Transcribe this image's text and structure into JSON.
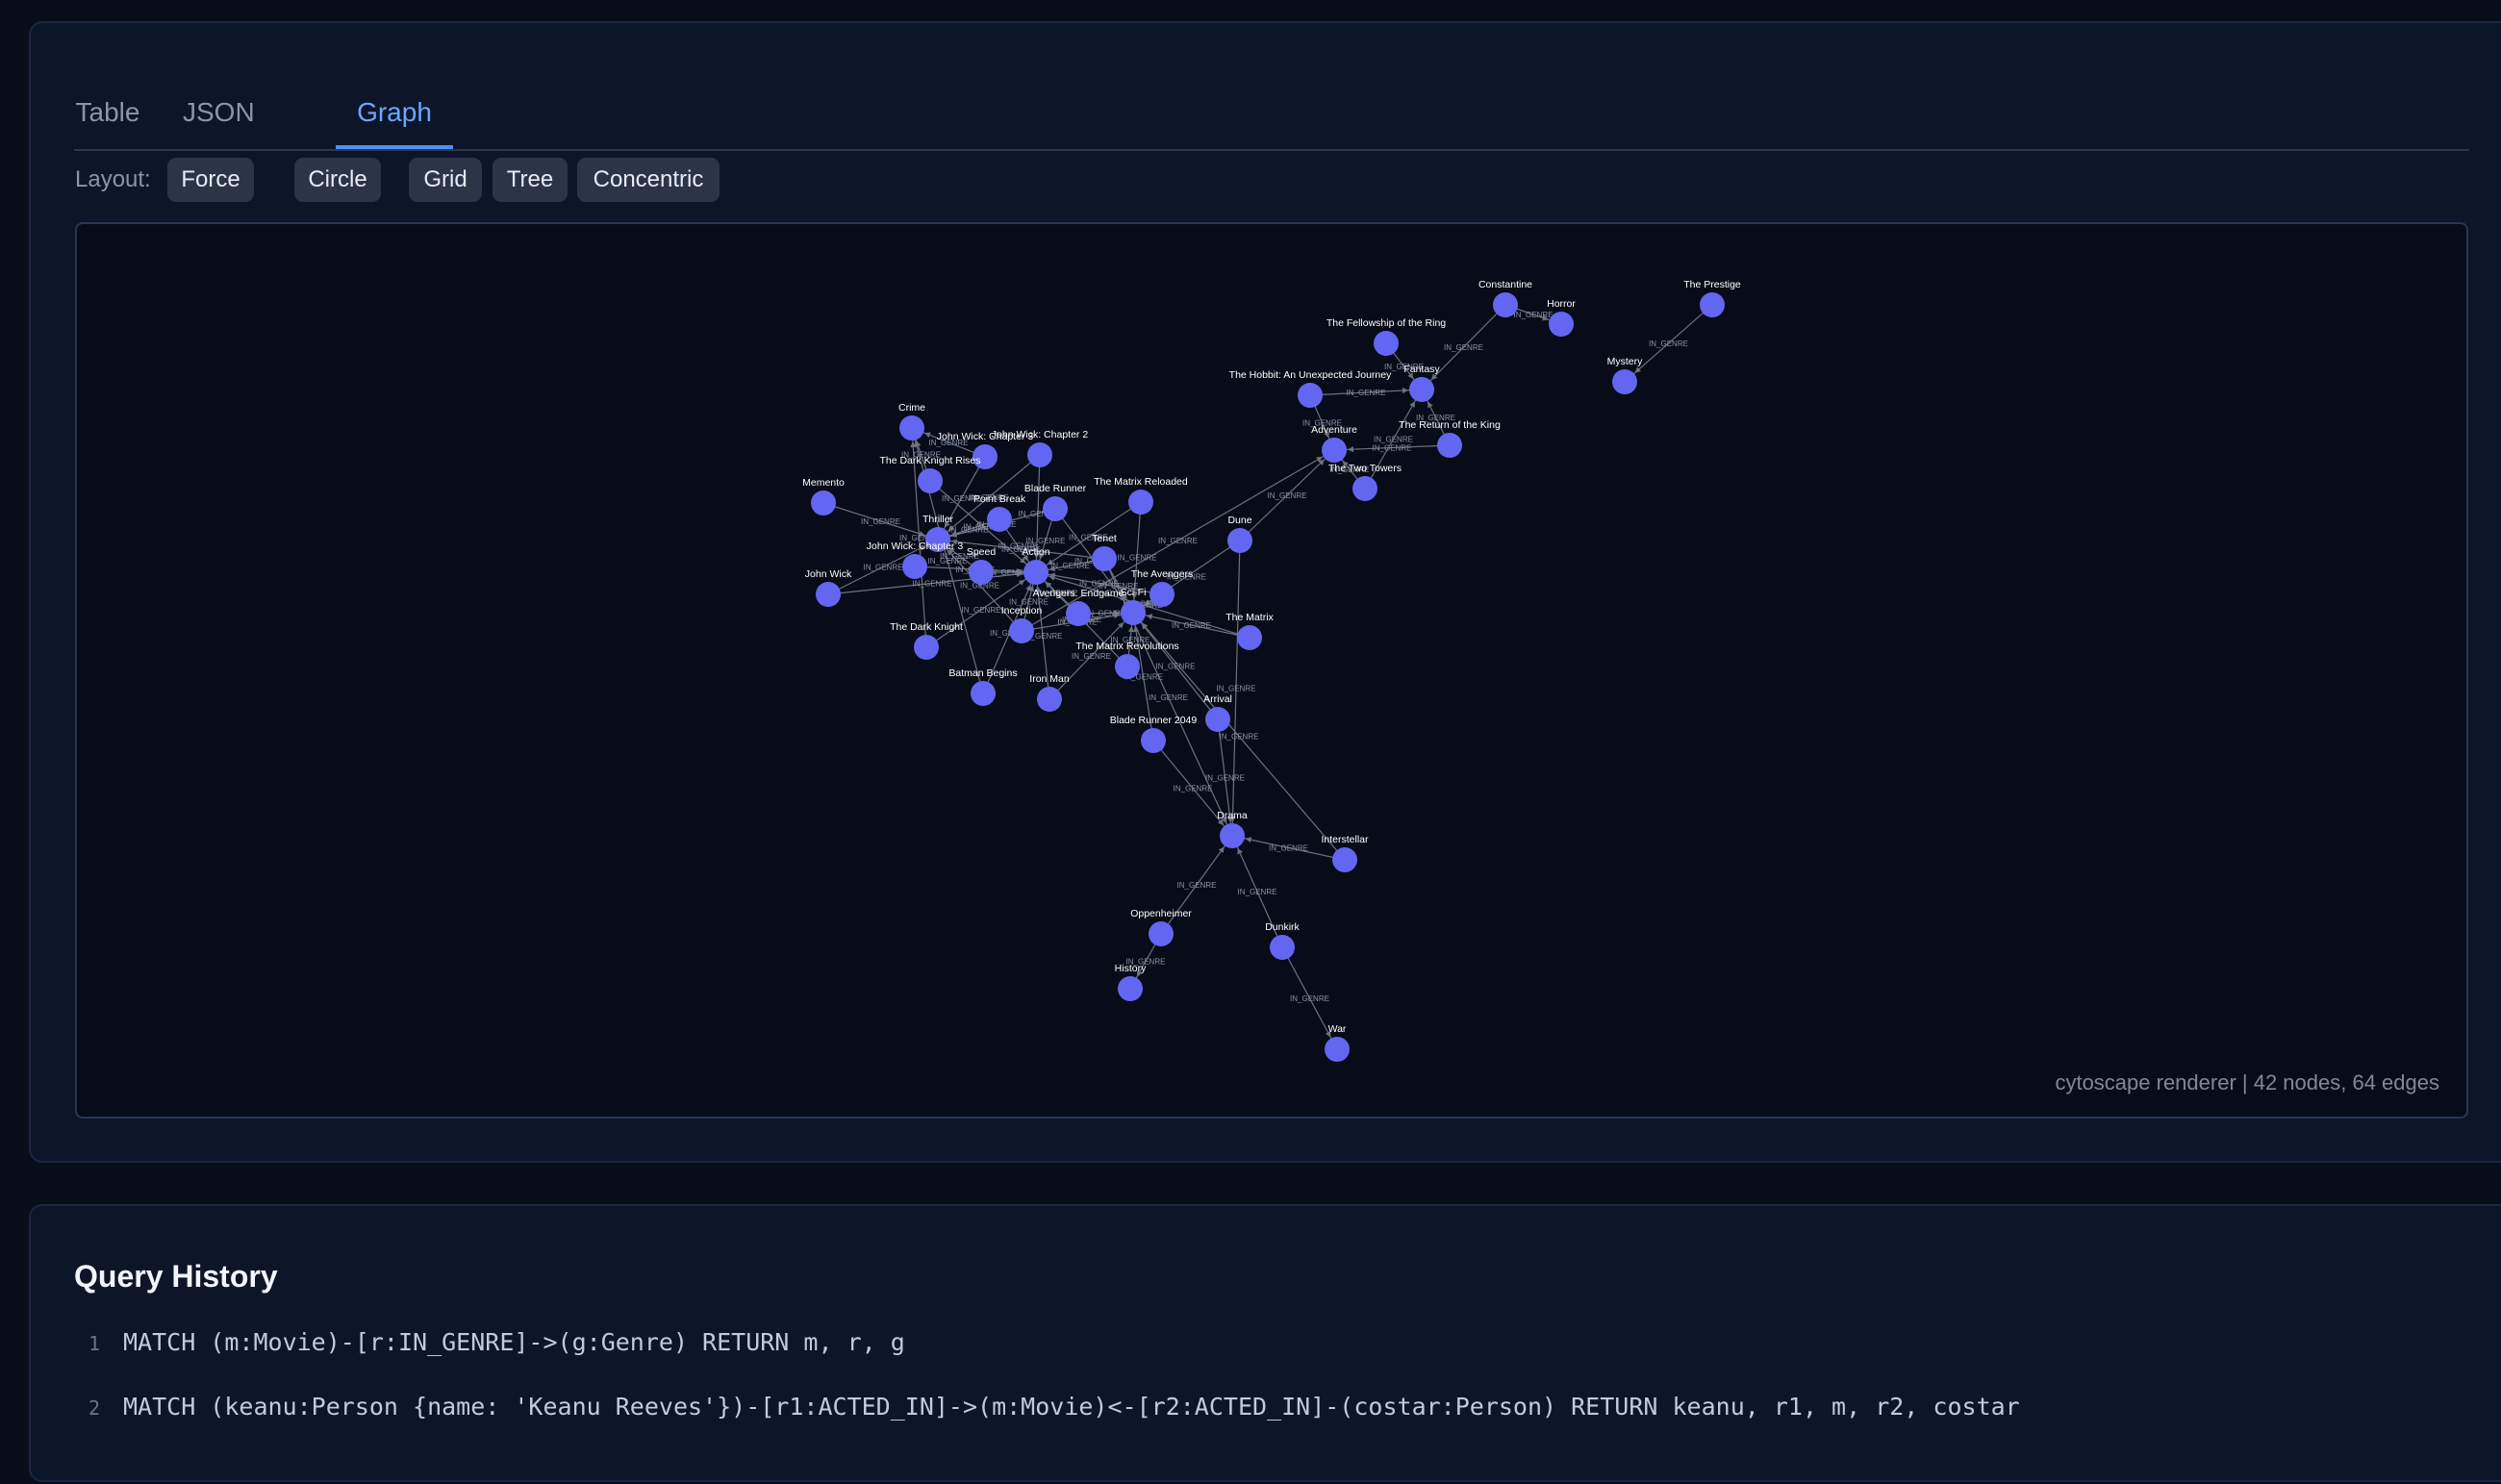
{
  "tabs": [
    {
      "label": "Table",
      "active": false
    },
    {
      "label": "JSON",
      "active": false
    },
    {
      "label": "Graph",
      "active": true
    }
  ],
  "layout": {
    "label": "Layout:",
    "options": [
      "Force",
      "Circle",
      "Grid",
      "Tree",
      "Concentric"
    ]
  },
  "graph": {
    "renderer_info": "cytoscape renderer | 42 nodes, 64 edges",
    "node_color": "#6366f1",
    "edge_color": "#6b7280",
    "nodes": [
      {
        "id": "constantine",
        "label": "Constantine"
      },
      {
        "id": "horror",
        "label": "Horror"
      },
      {
        "id": "the-prestige",
        "label": "The Prestige"
      },
      {
        "id": "fellowship",
        "label": "The Fellowship of the Ring"
      },
      {
        "id": "mystery",
        "label": "Mystery"
      },
      {
        "id": "hobbit",
        "label": "The Hobbit: An Unexpected Journey"
      },
      {
        "id": "fantasy",
        "label": "Fantasy"
      },
      {
        "id": "return-king",
        "label": "The Return of the King"
      },
      {
        "id": "adventure",
        "label": "Adventure"
      },
      {
        "id": "two-towers",
        "label": "The Two Towers"
      },
      {
        "id": "crime",
        "label": "Crime"
      },
      {
        "id": "john-wick-3",
        "label": "John Wick: Chapter 3"
      },
      {
        "id": "john-wick-2",
        "label": "John Wick: Chapter 2"
      },
      {
        "id": "dark-knight-rises",
        "label": "The Dark Knight Rises"
      },
      {
        "id": "memento",
        "label": "Memento"
      },
      {
        "id": "matrix-reloaded",
        "label": "The Matrix Reloaded"
      },
      {
        "id": "blade-runner",
        "label": "Blade Runner"
      },
      {
        "id": "point-break",
        "label": "Point Break"
      },
      {
        "id": "thriller",
        "label": "Thriller"
      },
      {
        "id": "dune",
        "label": "Dune"
      },
      {
        "id": "tenet",
        "label": "Tenet"
      },
      {
        "id": "john-wick-ch3",
        "label": "John Wick: Chapter 3"
      },
      {
        "id": "speed",
        "label": "Speed"
      },
      {
        "id": "action",
        "label": "Action"
      },
      {
        "id": "john-wick",
        "label": "John Wick"
      },
      {
        "id": "avengers",
        "label": "The Avengers"
      },
      {
        "id": "endgame",
        "label": "Avengers: Endgame"
      },
      {
        "id": "scifi",
        "label": "Sci-Fi"
      },
      {
        "id": "inception",
        "label": "Inception"
      },
      {
        "id": "the-matrix",
        "label": "The Matrix"
      },
      {
        "id": "dark-knight",
        "label": "The Dark Knight"
      },
      {
        "id": "matrix-revolutions",
        "label": "The Matrix Revolutions"
      },
      {
        "id": "batman-begins",
        "label": "Batman Begins"
      },
      {
        "id": "iron-man",
        "label": "Iron Man"
      },
      {
        "id": "arrival",
        "label": "Arrival"
      },
      {
        "id": "blade-runner-2049",
        "label": "Blade Runner 2049"
      },
      {
        "id": "drama",
        "label": "Drama"
      },
      {
        "id": "interstellar",
        "label": "Interstellar"
      },
      {
        "id": "oppenheimer",
        "label": "Oppenheimer"
      },
      {
        "id": "dunkirk",
        "label": "Dunkirk"
      },
      {
        "id": "history",
        "label": "History"
      },
      {
        "id": "war",
        "label": "War"
      }
    ],
    "edges": [
      {
        "source": "constantine",
        "target": "horror",
        "label": "IN_GENRE"
      },
      {
        "source": "constantine",
        "target": "fantasy",
        "label": "IN_GENRE"
      },
      {
        "source": "the-prestige",
        "target": "mystery",
        "label": "IN_GENRE"
      },
      {
        "source": "fellowship",
        "target": "fantasy",
        "label": "IN_GENRE"
      },
      {
        "source": "hobbit",
        "target": "fantasy",
        "label": "IN_GENRE"
      },
      {
        "source": "hobbit",
        "target": "adventure",
        "label": "IN_GENRE"
      },
      {
        "source": "return-king",
        "target": "fantasy",
        "label": "IN_GENRE"
      },
      {
        "source": "return-king",
        "target": "adventure",
        "label": "IN_GENRE"
      },
      {
        "source": "two-towers",
        "target": "fantasy",
        "label": "IN_GENRE"
      },
      {
        "source": "two-towers",
        "target": "adventure",
        "label": "IN_GENRE"
      },
      {
        "source": "dune",
        "target": "adventure",
        "label": "IN_GENRE"
      },
      {
        "source": "dune",
        "target": "scifi",
        "label": "IN_GENRE"
      },
      {
        "source": "dark-knight-rises",
        "target": "crime",
        "label": "IN_GENRE"
      },
      {
        "source": "dark-knight-rises",
        "target": "action",
        "label": "IN_GENRE"
      },
      {
        "source": "memento",
        "target": "thriller",
        "label": "IN_GENRE"
      },
      {
        "source": "john-wick",
        "target": "thriller",
        "label": "IN_GENRE"
      },
      {
        "source": "john-wick",
        "target": "action",
        "label": "IN_GENRE"
      },
      {
        "source": "john-wick-2",
        "target": "thriller",
        "label": "IN_GENRE"
      },
      {
        "source": "john-wick-2",
        "target": "action",
        "label": "IN_GENRE"
      },
      {
        "source": "john-wick-3",
        "target": "thriller",
        "label": "IN_GENRE"
      },
      {
        "source": "john-wick-3",
        "target": "crime",
        "label": "IN_GENRE"
      },
      {
        "source": "john-wick-ch3",
        "target": "action",
        "label": "IN_GENRE"
      },
      {
        "source": "point-break",
        "target": "thriller",
        "label": "IN_GENRE"
      },
      {
        "source": "point-break",
        "target": "action",
        "label": "IN_GENRE"
      },
      {
        "source": "speed",
        "target": "thriller",
        "label": "IN_GENRE"
      },
      {
        "source": "speed",
        "target": "action",
        "label": "IN_GENRE"
      },
      {
        "source": "blade-runner",
        "target": "scifi",
        "label": "IN_GENRE"
      },
      {
        "source": "blade-runner",
        "target": "thriller",
        "label": "IN_GENRE"
      },
      {
        "source": "matrix-reloaded",
        "target": "action",
        "label": "IN_GENRE"
      },
      {
        "source": "matrix-reloaded",
        "target": "scifi",
        "label": "IN_GENRE"
      },
      {
        "source": "tenet",
        "target": "action",
        "label": "IN_GENRE"
      },
      {
        "source": "tenet",
        "target": "scifi",
        "label": "IN_GENRE"
      },
      {
        "source": "tenet",
        "target": "thriller",
        "label": "IN_GENRE"
      },
      {
        "source": "avengers",
        "target": "action",
        "label": "IN_GENRE"
      },
      {
        "source": "avengers",
        "target": "scifi",
        "label": "IN_GENRE"
      },
      {
        "source": "endgame",
        "target": "action",
        "label": "IN_GENRE"
      },
      {
        "source": "endgame",
        "target": "scifi",
        "label": "IN_GENRE"
      },
      {
        "source": "the-matrix",
        "target": "action",
        "label": "IN_GENRE"
      },
      {
        "source": "the-matrix",
        "target": "scifi",
        "label": "IN_GENRE"
      },
      {
        "source": "inception",
        "target": "action",
        "label": "IN_GENRE"
      },
      {
        "source": "inception",
        "target": "scifi",
        "label": "IN_GENRE"
      },
      {
        "source": "inception",
        "target": "thriller",
        "label": "IN_GENRE"
      },
      {
        "source": "dark-knight",
        "target": "crime",
        "label": "IN_GENRE"
      },
      {
        "source": "dark-knight",
        "target": "action",
        "label": "IN_GENRE"
      },
      {
        "source": "matrix-revolutions",
        "target": "action",
        "label": "IN_GENRE"
      },
      {
        "source": "matrix-revolutions",
        "target": "scifi",
        "label": "IN_GENRE"
      },
      {
        "source": "batman-begins",
        "target": "action",
        "label": "IN_GENRE"
      },
      {
        "source": "batman-begins",
        "target": "crime",
        "label": "IN_GENRE"
      },
      {
        "source": "iron-man",
        "target": "action",
        "label": "IN_GENRE"
      },
      {
        "source": "iron-man",
        "target": "scifi",
        "label": "IN_GENRE"
      },
      {
        "source": "arrival",
        "target": "scifi",
        "label": "IN_GENRE"
      },
      {
        "source": "arrival",
        "target": "drama",
        "label": "IN_GENRE"
      },
      {
        "source": "blade-runner-2049",
        "target": "scifi",
        "label": "IN_GENRE"
      },
      {
        "source": "blade-runner-2049",
        "target": "drama",
        "label": "IN_GENRE"
      },
      {
        "source": "interstellar",
        "target": "drama",
        "label": "IN_GENRE"
      },
      {
        "source": "interstellar",
        "target": "scifi",
        "label": "IN_GENRE"
      },
      {
        "source": "oppenheimer",
        "target": "drama",
        "label": "IN_GENRE"
      },
      {
        "source": "oppenheimer",
        "target": "history",
        "label": "IN_GENRE"
      },
      {
        "source": "dunkirk",
        "target": "drama",
        "label": "IN_GENRE"
      },
      {
        "source": "dunkirk",
        "target": "war",
        "label": "IN_GENRE"
      },
      {
        "source": "tenet",
        "target": "drama",
        "label": "IN_GENRE"
      },
      {
        "source": "inception",
        "target": "adventure",
        "label": "IN_GENRE"
      },
      {
        "source": "dune",
        "target": "drama",
        "label": "IN_GENRE"
      },
      {
        "source": "blade-runner",
        "target": "action",
        "label": "IN_GENRE"
      }
    ]
  },
  "history": {
    "title": "Query History",
    "items": [
      {
        "num": "1",
        "query": "MATCH (m:Movie)-[r:IN_GENRE]->(g:Genre) RETURN m, r, g"
      },
      {
        "num": "2",
        "query": "MATCH (keanu:Person {name: 'Keanu Reeves'})-[r1:ACTED_IN]->(m:Movie)<-[r2:ACTED_IN]-(costar:Person) RETURN keanu, r1, m, r2, costar"
      }
    ]
  }
}
